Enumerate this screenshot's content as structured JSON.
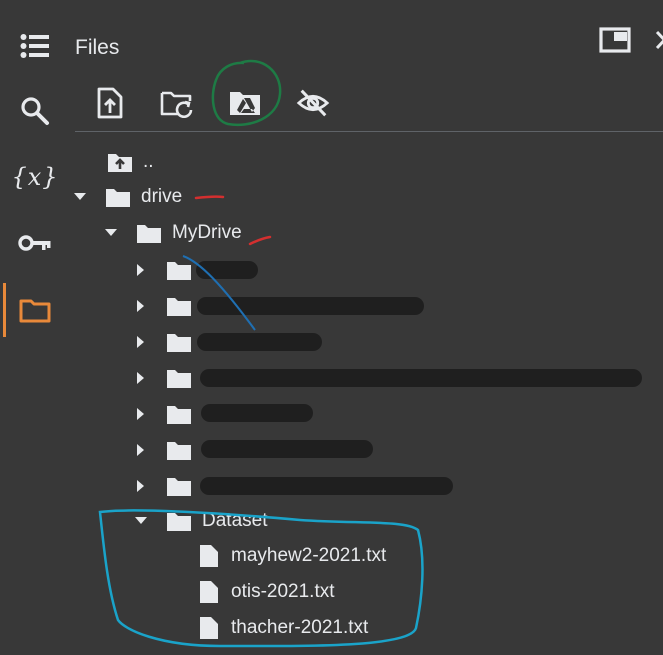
{
  "panel": {
    "title": "Files"
  },
  "rail": {
    "items": [
      {
        "name": "table-of-contents",
        "icon": "list-icon"
      },
      {
        "name": "find-replace",
        "icon": "search-icon"
      },
      {
        "name": "variables",
        "icon": "variables-icon",
        "glyph": "{x}"
      },
      {
        "name": "secrets",
        "icon": "key-icon"
      },
      {
        "name": "files",
        "icon": "folder-icon",
        "active": true
      }
    ]
  },
  "header_icons": [
    "window-icon",
    "close-icon"
  ],
  "toolbar": {
    "items": [
      {
        "name": "upload",
        "icon": "upload-file-icon"
      },
      {
        "name": "refresh",
        "icon": "folder-refresh-icon"
      },
      {
        "name": "mount-drive",
        "icon": "google-drive-folder-icon"
      },
      {
        "name": "toggle-hidden",
        "icon": "eye-off-icon"
      }
    ]
  },
  "tree": {
    "parent": "..",
    "drive": "drive",
    "mydrive": "MyDrive",
    "dataset": "Dataset",
    "files": [
      "mayhew2-2021.txt",
      "otis-2021.txt",
      "thacher-2021.txt"
    ]
  },
  "colors": {
    "background": "#383838",
    "text": "#e8eaed",
    "active_accent": "#e8893a",
    "redaction": "#1f1f1f",
    "annotation_green": "#1e7b45",
    "annotation_red": "#d32f2f",
    "annotation_cyan": "#1aa3c9"
  }
}
